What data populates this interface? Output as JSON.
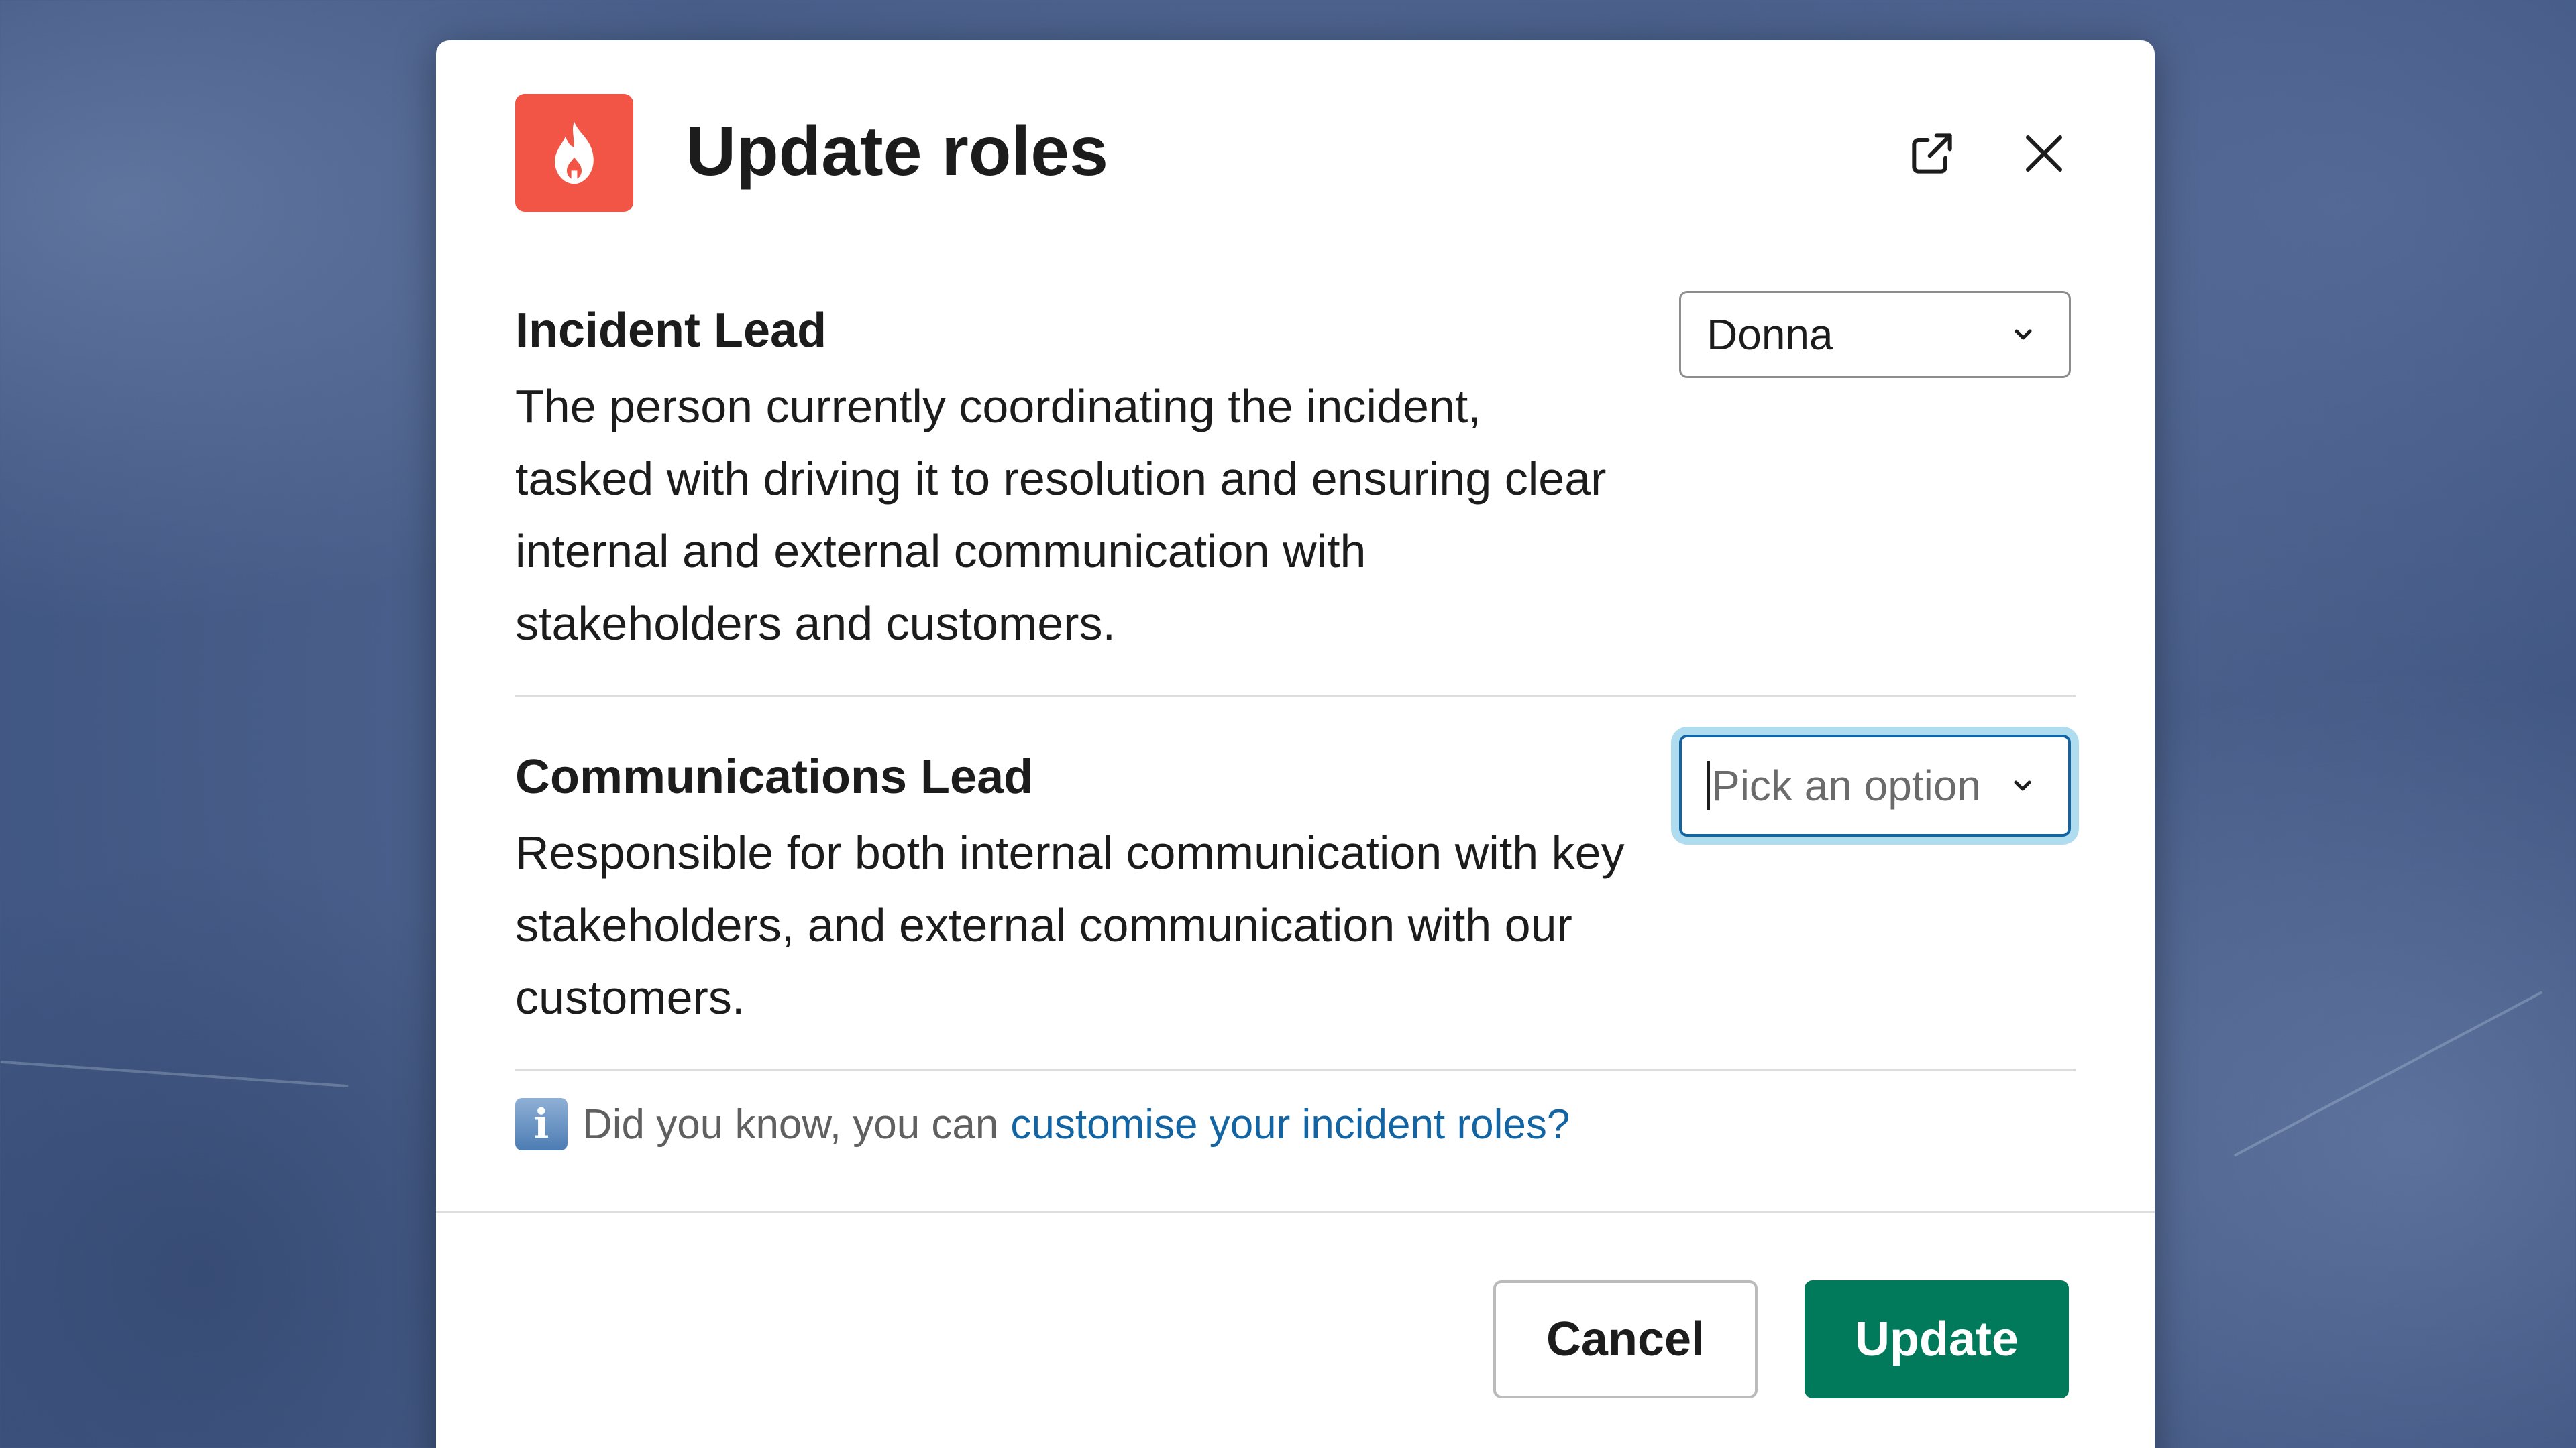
{
  "modal": {
    "title": "Update roles",
    "app_icon": "flame-icon",
    "header_icons": [
      "external-link-icon",
      "close-icon"
    ]
  },
  "roles": [
    {
      "title": "Incident Lead",
      "description": "The person currently coordinating the incident, tasked with driving it to resolution and ensuring clear internal and external communication with stakeholders and customers.",
      "select_value": "Donna"
    },
    {
      "title": "Communications Lead",
      "description": "Responsible for both internal communication with key stakeholders, and external communication with our customers.",
      "select_placeholder": "Pick an option"
    }
  ],
  "tip": {
    "icon": "info-icon",
    "text": "Did you know, you can",
    "link": "customise your incident roles?"
  },
  "footer": {
    "cancel_label": "Cancel",
    "update_label": "Update"
  },
  "colors": {
    "brand": "#f25446",
    "primary_button": "#007a5a",
    "link": "#1264a3",
    "focus": "#1264a3"
  }
}
